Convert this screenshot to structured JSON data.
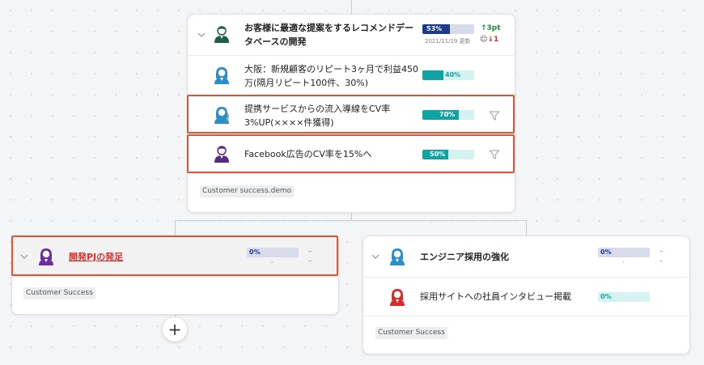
{
  "top_card": {
    "main": {
      "title": "お客様に最適な提案をするレコメンドデータベースの開発",
      "progress": 53,
      "progress_label": "53%",
      "updated": "2021/11/19 更新",
      "delta_up": "3pt",
      "delta_down": "1",
      "colors": {
        "bar_fill": "#1e3a8a",
        "bar_bg": "#d7dbec",
        "up": "#1a8a3a",
        "down": "#d9302c"
      }
    },
    "items": [
      {
        "title": "大阪：新規顧客のリピート3ヶ月で利益450万(隔月リピート100件、30%)",
        "progress": 40,
        "progress_label": "40%",
        "avatar": "female-blue-avatar",
        "highlighted": false
      },
      {
        "title": "提携サービスからの流入導線をCV率3%UP(××××件獲得)",
        "progress": 70,
        "progress_label": "70%",
        "avatar": "female-blue-half-avatar",
        "highlighted": true
      },
      {
        "title": "Facebook広告のCV率を15%へ",
        "progress": 50,
        "progress_label": "50%",
        "avatar": "male-purple-avatar",
        "highlighted": true
      }
    ],
    "tag": "Customer success.demo"
  },
  "left_card": {
    "title": "開発PJの発足",
    "progress": 0,
    "progress_label": "0%",
    "dash1": "–",
    "dash2": "–",
    "dot": "-",
    "tag": "Customer Success",
    "add_button": "+"
  },
  "right_card": {
    "title": "エンジニア採用の強化",
    "progress": 0,
    "progress_label": "0%",
    "dash1": "–",
    "dash2": "–",
    "dot": "-",
    "items": [
      {
        "title": "採用サイトへの社員インタビュー掲載",
        "progress": 0,
        "progress_label": "0%",
        "avatar": "female-red-avatar"
      }
    ],
    "tag": "Customer Success"
  },
  "colors": {
    "teal": "#0fa3a3",
    "teal_bg": "#d3f2f0",
    "navy_bg": "#d7dbec",
    "highlight": "#d95533",
    "link_red": "#d9302c"
  }
}
